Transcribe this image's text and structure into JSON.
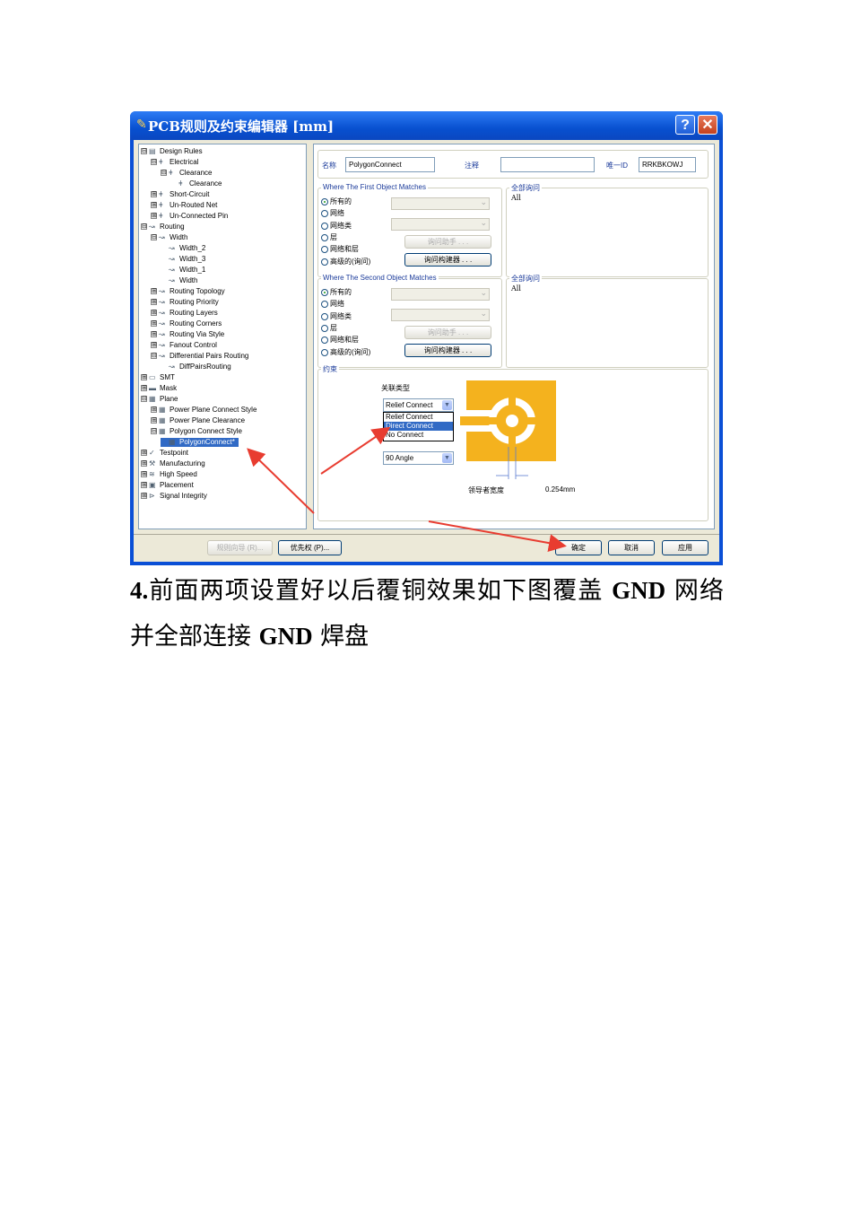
{
  "window": {
    "title": "PCB规则及约束编辑器 [mm]",
    "help": "?",
    "close": "✕"
  },
  "tree": [
    {
      "label": "Design Rules",
      "exp": "⊟",
      "icon": "rules-icon"
    },
    {
      "label": "Electrical",
      "exp": "⊟",
      "icon": "electrical-icon"
    },
    {
      "label": "Clearance",
      "exp": "⊟",
      "icon": "electrical-icon"
    },
    {
      "label": "Clearance",
      "exp": "",
      "icon": "electrical-icon"
    },
    {
      "label": "Short-Circuit",
      "exp": "⊞",
      "icon": "electrical-icon"
    },
    {
      "label": "Un-Routed Net",
      "exp": "⊞",
      "icon": "electrical-icon"
    },
    {
      "label": "Un-Connected Pin",
      "exp": "⊞",
      "icon": "electrical-icon"
    },
    {
      "label": "Routing",
      "exp": "⊟",
      "icon": "routing-icon"
    },
    {
      "label": "Width",
      "exp": "⊟",
      "icon": "routing-icon"
    },
    {
      "label": "Width_2",
      "exp": "",
      "icon": "routing-icon"
    },
    {
      "label": "Width_3",
      "exp": "",
      "icon": "routing-icon"
    },
    {
      "label": "Width_1",
      "exp": "",
      "icon": "routing-icon"
    },
    {
      "label": "Width",
      "exp": "",
      "icon": "routing-icon"
    },
    {
      "label": "Routing Topology",
      "exp": "⊞",
      "icon": "routing-icon"
    },
    {
      "label": "Routing Priority",
      "exp": "⊞",
      "icon": "routing-icon"
    },
    {
      "label": "Routing Layers",
      "exp": "⊞",
      "icon": "routing-icon"
    },
    {
      "label": "Routing Corners",
      "exp": "⊞",
      "icon": "routing-icon"
    },
    {
      "label": "Routing Via Style",
      "exp": "⊞",
      "icon": "routing-icon"
    },
    {
      "label": "Fanout Control",
      "exp": "⊞",
      "icon": "routing-icon"
    },
    {
      "label": "Differential Pairs Routing",
      "exp": "⊟",
      "icon": "routing-icon"
    },
    {
      "label": "DiffPairsRouting",
      "exp": "",
      "icon": "routing-icon"
    },
    {
      "label": "SMT",
      "exp": "⊞",
      "icon": "smt-icon"
    },
    {
      "label": "Mask",
      "exp": "⊞",
      "icon": "mask-icon"
    },
    {
      "label": "Plane",
      "exp": "⊟",
      "icon": "plane-icon"
    },
    {
      "label": "Power Plane Connect Style",
      "exp": "⊞",
      "icon": "plane-icon"
    },
    {
      "label": "Power Plane Clearance",
      "exp": "⊞",
      "icon": "plane-icon"
    },
    {
      "label": "Polygon Connect Style",
      "exp": "⊟",
      "icon": "plane-icon"
    },
    {
      "label": "PolygonConnect*",
      "exp": "",
      "icon": "plane-icon"
    },
    {
      "label": "Testpoint",
      "exp": "⊞",
      "icon": "testpoint-icon"
    },
    {
      "label": "Manufacturing",
      "exp": "⊞",
      "icon": "manufacturing-icon"
    },
    {
      "label": "High Speed",
      "exp": "⊞",
      "icon": "highspeed-icon"
    },
    {
      "label": "Placement",
      "exp": "⊞",
      "icon": "placement-icon"
    },
    {
      "label": "Signal Integrity",
      "exp": "⊞",
      "icon": "signal-icon"
    }
  ],
  "rule": {
    "name_label": "名称",
    "name_value": "PolygonConnect",
    "comment_label": "注释",
    "comment_value": "",
    "id_label": "唯一ID",
    "id_value": "RRKBKOWJ"
  },
  "first": {
    "title": "Where The First Object Matches",
    "options": [
      "所有的",
      "网络",
      "网络类",
      "层",
      "网络和层",
      "高级的(询问)"
    ],
    "query_helper": "询问助手 . . .",
    "query_builder": "询问构建器 . . .",
    "full_query_title": "全部询问",
    "full_query": "All"
  },
  "second": {
    "title": "Where The Second Object Matches",
    "options": [
      "所有的",
      "网络",
      "网络类",
      "层",
      "网络和层",
      "高级的(询问)"
    ],
    "query_helper": "询问助手 . . .",
    "query_builder": "询问构建器 . . .",
    "full_query_title": "全部询问",
    "full_query": "All"
  },
  "constraints": {
    "title": "约束",
    "connect_type_label": "关联类型",
    "connect_type_value": "Relief Connect",
    "dropdown": [
      "Relief Connect",
      "Direct Connect",
      "No Connect"
    ],
    "dropdown_highlight": 1,
    "angle_value": "90 Angle",
    "conductor_width_label": "领导者宽度",
    "conductor_width_value": "0.254mm",
    "copper_color": "#f4b21e"
  },
  "buttons": {
    "rule_wizard": "规则向导 (R)...",
    "priorities": "优先权 (P)...",
    "ok": "确定",
    "cancel": "取消",
    "apply": "应用"
  },
  "caption": {
    "num": "4.",
    "t1": "前面两项设置好以后覆铜效果如下图覆盖 ",
    "gnd1": "GND",
    "t2": " 网络并全部连接 ",
    "gnd2": "GND",
    "t3": " 焊盘"
  }
}
